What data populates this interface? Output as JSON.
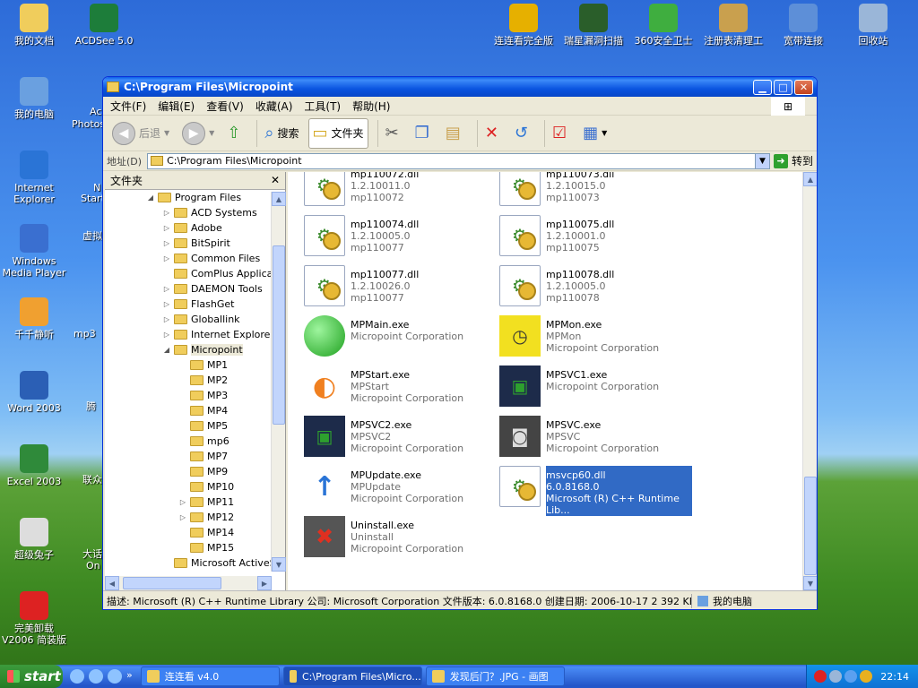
{
  "desktop": {
    "icons": [
      {
        "label": "我的文档",
        "icon": "my-documents-icon",
        "color": "#f0cd5c"
      },
      {
        "label": "ACDSee 5.0",
        "icon": "acdsee-icon",
        "color": "#1d7d3a"
      },
      {
        "label": "我的电脑",
        "icon": "my-computer-icon",
        "color": "#6aa0e0"
      },
      {
        "label": "Internet Explorer",
        "icon": "ie-icon",
        "color": "#2a74d6"
      },
      {
        "label": "Windows Media Player",
        "icon": "media-player-icon",
        "color": "#3a6fd0"
      },
      {
        "label": "千千静听",
        "icon": "ttplayer-icon",
        "color": "#f0a030"
      },
      {
        "label": "Word 2003",
        "icon": "word-icon",
        "color": "#2b5fb5"
      },
      {
        "label": "Excel 2003",
        "icon": "excel-icon",
        "color": "#2f8a3a"
      },
      {
        "label": "超级兔子",
        "icon": "rabbit-icon",
        "color": "#dddddd"
      },
      {
        "label": "完美卸载 V2006 简装版",
        "icon": "uninstaller-icon",
        "color": "#d22"
      },
      {
        "label": "连连看完全版",
        "icon": "game-icon",
        "color": "#e6b000"
      },
      {
        "label": "瑞星漏洞扫描",
        "icon": "rising-scan-icon",
        "color": "#2a5e2a"
      },
      {
        "label": "360安全卫士",
        "icon": "security-360-icon",
        "color": "#3fae3f"
      },
      {
        "label": "注册表清理工",
        "icon": "registry-cleaner-icon",
        "color": "#c9a04e"
      },
      {
        "label": "宽带连接",
        "icon": "broadband-icon",
        "color": "#5d8fd8"
      },
      {
        "label": "回收站",
        "icon": "recycle-bin-icon",
        "color": "#9ab6d8"
      }
    ],
    "partial_labels": [
      "Ac",
      "Photos",
      "N",
      "Start",
      "虚拟",
      "mp3",
      "腾",
      "联众",
      "大话",
      "On"
    ]
  },
  "window": {
    "title": "C:\\Program Files\\Micropoint",
    "menu": [
      "文件(F)",
      "编辑(E)",
      "查看(V)",
      "收藏(A)",
      "工具(T)",
      "帮助(H)"
    ],
    "toolbar": {
      "back": "后退",
      "search": "搜索",
      "folders": "文件夹"
    },
    "address": {
      "label": "地址(D)",
      "value": "C:\\Program Files\\Micropoint",
      "go": "转到"
    },
    "folder_pane": {
      "title": "文件夹",
      "items": [
        {
          "label": "Program Files",
          "level": 0,
          "exp": "◢"
        },
        {
          "label": "ACD Systems",
          "level": 1,
          "exp": "▷"
        },
        {
          "label": "Adobe",
          "level": 1,
          "exp": "▷"
        },
        {
          "label": "BitSpirit",
          "level": 1,
          "exp": "▷"
        },
        {
          "label": "Common Files",
          "level": 1,
          "exp": "▷"
        },
        {
          "label": "ComPlus Applicatio",
          "level": 1,
          "exp": ""
        },
        {
          "label": "DAEMON Tools",
          "level": 1,
          "exp": "▷"
        },
        {
          "label": "FlashGet",
          "level": 1,
          "exp": "▷"
        },
        {
          "label": "Globallink",
          "level": 1,
          "exp": "▷"
        },
        {
          "label": "Internet Explorer",
          "level": 1,
          "exp": "▷"
        },
        {
          "label": "Micropoint",
          "level": 1,
          "exp": "◢",
          "selected": true
        },
        {
          "label": "MP1",
          "level": 2,
          "exp": ""
        },
        {
          "label": "MP2",
          "level": 2,
          "exp": ""
        },
        {
          "label": "MP3",
          "level": 2,
          "exp": ""
        },
        {
          "label": "MP4",
          "level": 2,
          "exp": ""
        },
        {
          "label": "MP5",
          "level": 2,
          "exp": ""
        },
        {
          "label": "mp6",
          "level": 2,
          "exp": ""
        },
        {
          "label": "MP7",
          "level": 2,
          "exp": ""
        },
        {
          "label": "MP9",
          "level": 2,
          "exp": ""
        },
        {
          "label": "MP10",
          "level": 2,
          "exp": ""
        },
        {
          "label": "MP11",
          "level": 2,
          "exp": "▷"
        },
        {
          "label": "MP12",
          "level": 2,
          "exp": "▷"
        },
        {
          "label": "MP14",
          "level": 2,
          "exp": ""
        },
        {
          "label": "MP15",
          "level": 2,
          "exp": ""
        },
        {
          "label": "Microsoft ActiveSy",
          "level": 1,
          "exp": ""
        }
      ]
    },
    "files": [
      {
        "name": "mp110072.dll",
        "l2": "1.2.10011.0",
        "l3": "mp110072",
        "type": "dll"
      },
      {
        "name": "mp110073.dll",
        "l2": "1.2.10015.0",
        "l3": "mp110073",
        "type": "dll"
      },
      {
        "name": "mp110074.dll",
        "l2": "1.2.10005.0",
        "l3": "mp110077",
        "type": "dll"
      },
      {
        "name": "mp110075.dll",
        "l2": "1.2.10001.0",
        "l3": "mp110075",
        "type": "dll"
      },
      {
        "name": "mp110077.dll",
        "l2": "1.2.10026.0",
        "l3": "mp110077",
        "type": "dll"
      },
      {
        "name": "mp110078.dll",
        "l2": "1.2.10005.0",
        "l3": "mp110078",
        "type": "dll"
      },
      {
        "name": "MPMain.exe",
        "l2": "Micropoint Corporation",
        "l3": "",
        "type": "green-ball"
      },
      {
        "name": "MPMon.exe",
        "l2": "MPMon",
        "l3": "Micropoint Corporation",
        "type": "mon"
      },
      {
        "name": "MPStart.exe",
        "l2": "MPStart",
        "l3": "Micropoint Corporation",
        "type": "start"
      },
      {
        "name": "MPSVC1.exe",
        "l2": "Micropoint Corporation",
        "l3": "",
        "type": "service"
      },
      {
        "name": "MPSVC2.exe",
        "l2": "MPSVC2",
        "l3": "Micropoint Corporation",
        "type": "service2"
      },
      {
        "name": "MPSVC.exe",
        "l2": "MPSVC",
        "l3": "Micropoint Corporation",
        "type": "svc"
      },
      {
        "name": "MPUpdate.exe",
        "l2": "MPUpdate",
        "l3": "Micropoint Corporation",
        "type": "update"
      },
      {
        "name": "msvcp60.dll",
        "l2": "6.0.8168.0",
        "l3": "Microsoft (R) C++ Runtime Lib...",
        "type": "dll",
        "selected": true
      },
      {
        "name": "Uninstall.exe",
        "l2": "Uninstall",
        "l3": "Micropoint Corporation",
        "type": "uninstall"
      }
    ],
    "status": {
      "text": "描述: Microsoft (R) C++ Runtime Library 公司: Microsoft Corporation 文件版本: 6.0.8168.0 创建日期: 2006-10-17 2 392 KB",
      "location": "我的电脑"
    }
  },
  "taskbar": {
    "start": "start",
    "tasks": [
      "连连看 v4.0",
      "C:\\Program Files\\Micro...",
      "发现后门？.JPG - 画图"
    ],
    "clock": "22:14"
  }
}
